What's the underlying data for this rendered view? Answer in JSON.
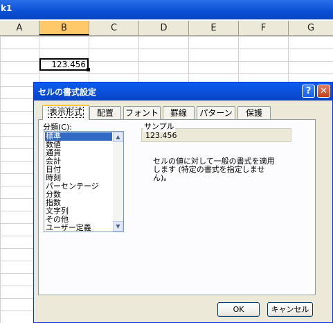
{
  "window": {
    "title_fragment": "k1"
  },
  "sheet": {
    "columns": [
      "A",
      "B",
      "C",
      "D",
      "E",
      "F",
      "G"
    ],
    "active_column": "B",
    "active_cell_value": "123.456"
  },
  "dialog": {
    "title": "セルの書式設定",
    "help_glyph": "?",
    "close_glyph": "✕",
    "tabs": [
      {
        "label": "表示形式",
        "active": true
      },
      {
        "label": "配置",
        "active": false
      },
      {
        "label": "フォント",
        "active": false
      },
      {
        "label": "罫線",
        "active": false
      },
      {
        "label": "パターン",
        "active": false
      },
      {
        "label": "保護",
        "active": false
      }
    ],
    "category_label": "分類(C):",
    "categories": [
      "標準",
      "数値",
      "通貨",
      "会計",
      "日付",
      "時刻",
      "パーセンテージ",
      "分数",
      "指数",
      "文字列",
      "その他",
      "ユーザー定義"
    ],
    "selected_category": "標準",
    "sample_label": "サンプル",
    "sample_value": "123.456",
    "description": "セルの値に対して一般の書式を適用します (特定の書式を指定しません)。",
    "ok_label": "OK",
    "cancel_label": "キャンセル"
  },
  "icons": {
    "scroll_up": "up-arrow-icon",
    "scroll_down": "down-arrow-icon"
  }
}
